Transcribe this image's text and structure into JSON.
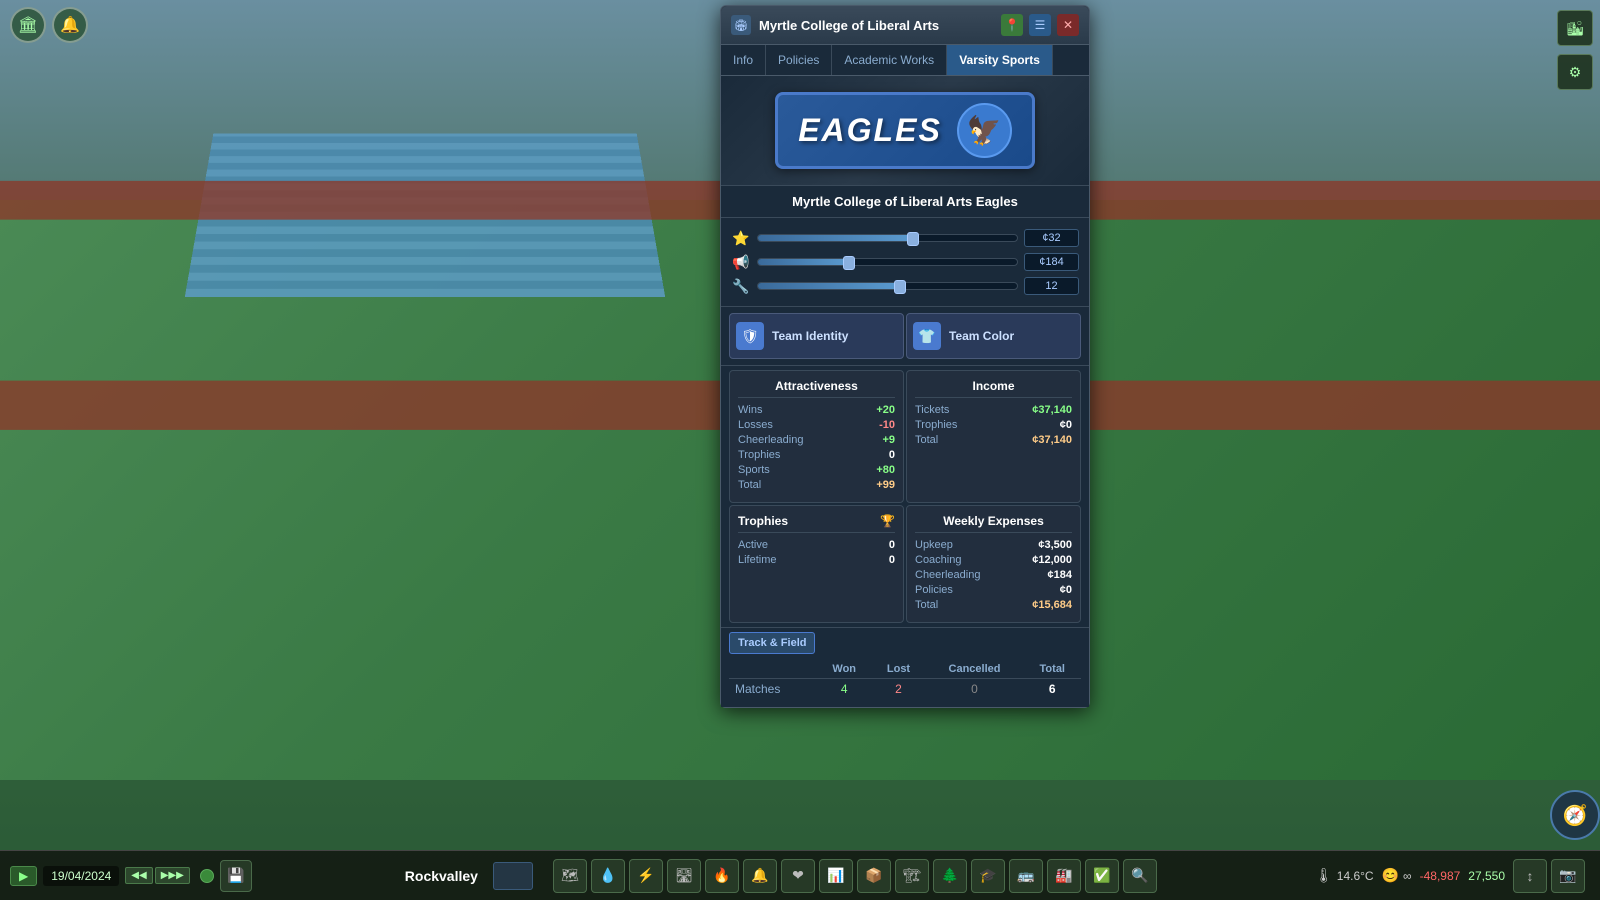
{
  "window": {
    "title": "Myrtle College of Liberal Arts",
    "tabs": [
      "Info",
      "Policies",
      "Academic Works",
      "Varsity Sports"
    ],
    "active_tab": "Varsity Sports"
  },
  "team": {
    "name": "Eagles",
    "full_name": "Myrtle College of Liberal Arts Eagles",
    "logo_text": "EAGLES"
  },
  "sliders": [
    {
      "icon": "⭐",
      "value": 32,
      "percent": 60,
      "display": "¢32"
    },
    {
      "icon": "📢",
      "value": 184,
      "percent": 35,
      "display": "¢184"
    },
    {
      "icon": "🔧",
      "value": 12,
      "percent": 55,
      "display": "12"
    }
  ],
  "identity": {
    "team_identity_label": "Team Identity",
    "team_color_label": "Team Color"
  },
  "attractiveness": {
    "title": "Attractiveness",
    "rows": [
      {
        "label": "Wins",
        "value": "+20",
        "type": "positive"
      },
      {
        "label": "Losses",
        "value": "-10",
        "type": "negative"
      },
      {
        "label": "Cheerleading",
        "value": "+9",
        "type": "positive"
      },
      {
        "label": "Trophies",
        "value": "0",
        "type": "neutral"
      },
      {
        "label": "Sports",
        "value": "+80",
        "type": "positive"
      },
      {
        "label": "Total",
        "value": "+99",
        "type": "total"
      }
    ]
  },
  "income": {
    "title": "Income",
    "rows": [
      {
        "label": "Tickets",
        "value": "¢37,140",
        "type": "positive"
      },
      {
        "label": "Trophies",
        "value": "¢0",
        "type": "neutral"
      },
      {
        "label": "Total",
        "value": "¢37,140",
        "type": "total"
      }
    ]
  },
  "weekly_expenses": {
    "title": "Weekly Expenses",
    "rows": [
      {
        "label": "Upkeep",
        "value": "¢3,500",
        "type": "neutral"
      },
      {
        "label": "Coaching",
        "value": "¢12,000",
        "type": "neutral"
      },
      {
        "label": "Cheerleading",
        "value": "¢184",
        "type": "neutral"
      },
      {
        "label": "Policies",
        "value": "¢0",
        "type": "neutral"
      },
      {
        "label": "Total",
        "value": "¢15,684",
        "type": "total"
      }
    ]
  },
  "trophies": {
    "title": "Trophies",
    "rows": [
      {
        "label": "Active",
        "value": "0"
      },
      {
        "label": "Lifetime",
        "value": "0"
      }
    ]
  },
  "track_field": {
    "section_label": "Track & Field",
    "columns": [
      "Won",
      "Lost",
      "Cancelled",
      "Total"
    ],
    "rows": [
      {
        "label": "Matches",
        "won": "4",
        "lost": "2",
        "cancelled": "0",
        "total": "6"
      }
    ]
  },
  "header_icons": {
    "location": "📍",
    "list": "☰",
    "close": "✕"
  },
  "bottom_bar": {
    "play_label": "▶",
    "date": "19/04/2024",
    "speed_buttons": [
      "◀◀",
      "▶▶▶"
    ],
    "city_name": "Rockvalley",
    "temperature": "14.6°C",
    "infinity": "∞",
    "money_change": "-48,987",
    "balance": "27,550",
    "happiness": "😊"
  },
  "toolbar_top": {
    "btn1": "🏛",
    "btn2": "🔔"
  },
  "side_toolbar": {
    "items": [
      "🏙",
      "⚙"
    ]
  }
}
